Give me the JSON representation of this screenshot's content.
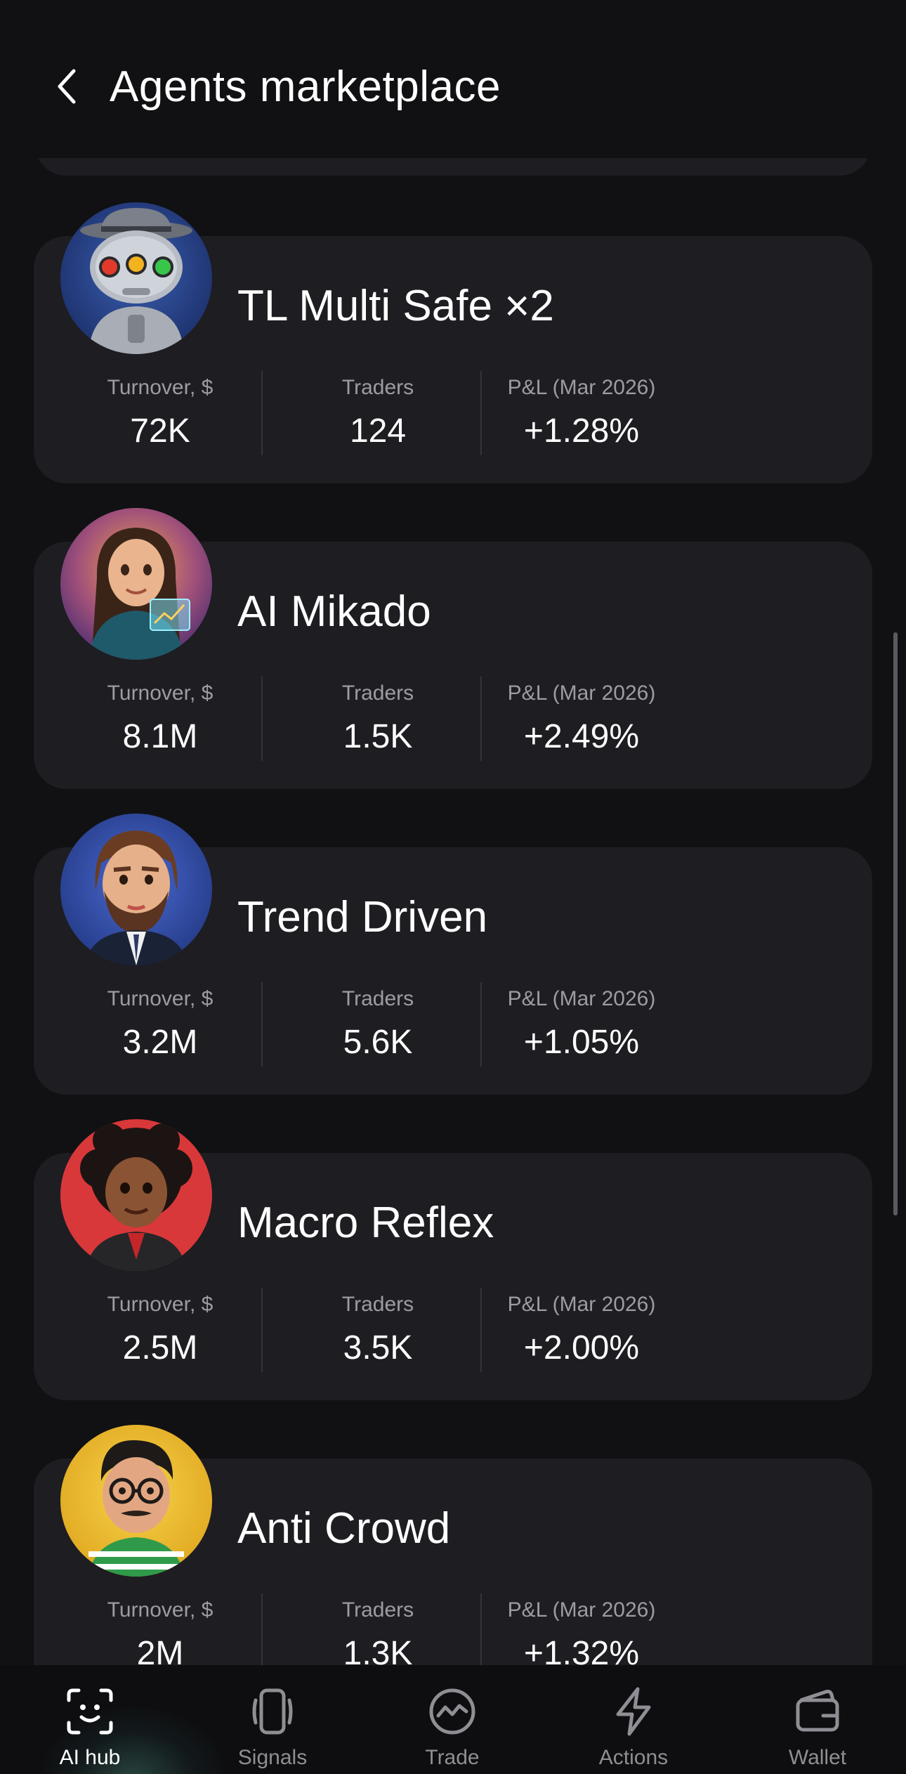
{
  "header": {
    "title": "Agents marketplace"
  },
  "agents": [
    {
      "name": "TL Multi Safe ×2",
      "avatar": "robot-avatar",
      "turnover_label": "Turnover, $",
      "turnover": "72K",
      "traders_label": "Traders",
      "traders": "124",
      "pnl_label": "P&L (Mar 2026)",
      "pnl": "+1.28%"
    },
    {
      "name": "AI Mikado",
      "avatar": "woman-trader-avatar",
      "turnover_label": "Turnover, $",
      "turnover": "8.1M",
      "traders_label": "Traders",
      "traders": "1.5K",
      "pnl_label": "P&L (Mar 2026)",
      "pnl": "+2.49%"
    },
    {
      "name": "Trend Driven",
      "avatar": "bearded-man-avatar",
      "turnover_label": "Turnover, $",
      "turnover": "3.2M",
      "traders_label": "Traders",
      "traders": "5.6K",
      "pnl_label": "P&L (Mar 2026)",
      "pnl": "+1.05%"
    },
    {
      "name": "Macro Reflex",
      "avatar": "curly-hair-woman-avatar",
      "turnover_label": "Turnover, $",
      "turnover": "2.5M",
      "traders_label": "Traders",
      "traders": "3.5K",
      "pnl_label": "P&L (Mar 2026)",
      "pnl": "+2.00%"
    },
    {
      "name": "Anti Crowd",
      "avatar": "glasses-man-avatar",
      "turnover_label": "Turnover, $",
      "turnover": "2M",
      "traders_label": "Traders",
      "traders": "1.3K",
      "pnl_label": "P&L (Mar 2026)",
      "pnl": "+1.32%"
    }
  ],
  "tabbar": {
    "items": [
      {
        "label": "AI hub",
        "icon": "ai-face-icon",
        "active": true
      },
      {
        "label": "Signals",
        "icon": "signals-icon",
        "active": false
      },
      {
        "label": "Trade",
        "icon": "trade-icon",
        "active": false
      },
      {
        "label": "Actions",
        "icon": "lightning-icon",
        "active": false
      },
      {
        "label": "Wallet",
        "icon": "wallet-icon",
        "active": false
      }
    ]
  },
  "colors": {
    "background": "#111113",
    "card": "#1d1d22",
    "muted_text": "#9c9ca3",
    "tab_inactive": "#8e8e94"
  }
}
